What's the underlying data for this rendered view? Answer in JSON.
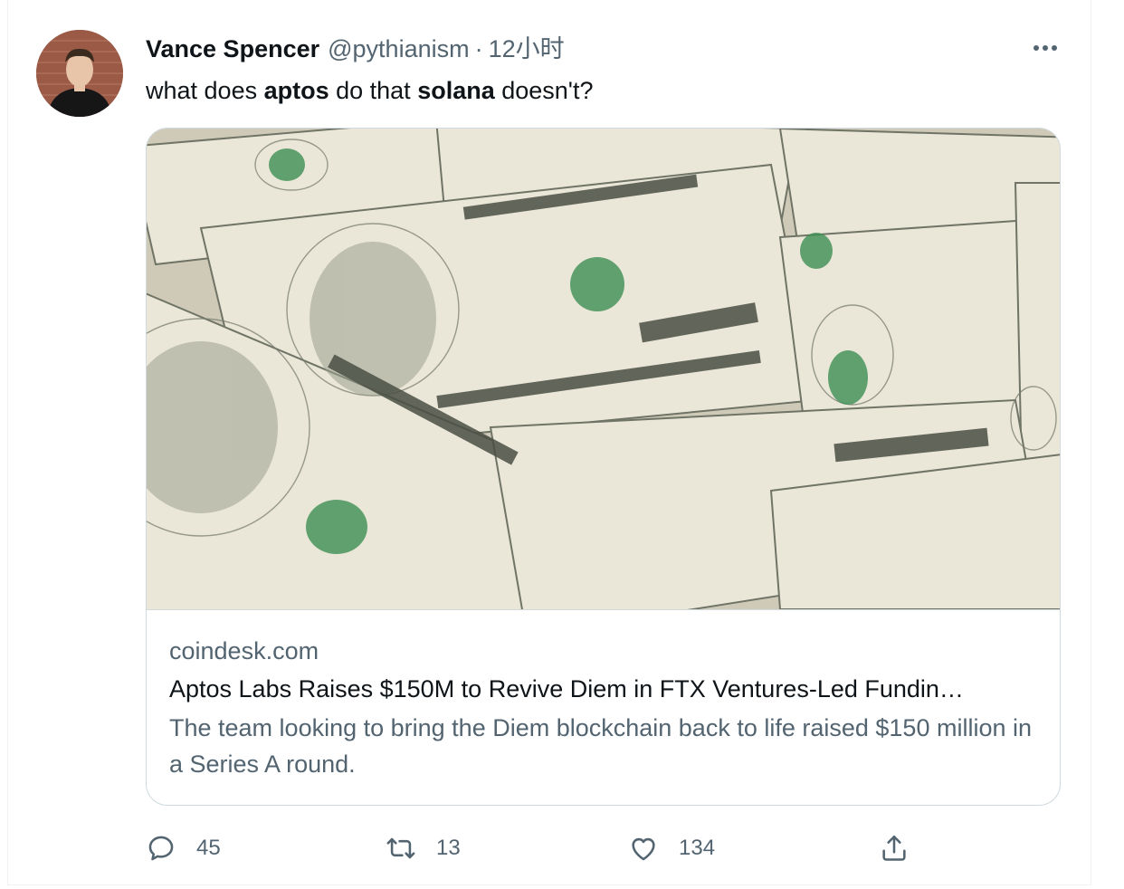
{
  "tweet": {
    "author_name": "Vance Spencer",
    "handle": "@pythianism",
    "separator": "·",
    "time": "12小时",
    "text_parts": [
      "what does ",
      "aptos",
      " do that ",
      "solana",
      " doesn't?"
    ]
  },
  "card": {
    "domain": "coindesk.com",
    "title": "Aptos Labs Raises $150M to Revive Diem in FTX Ventures-Led Fundin…",
    "description": "The team looking to bring the Diem blockchain back to life raised $150 million in a Series A round."
  },
  "actions": {
    "reply_count": "45",
    "retweet_count": "13",
    "like_count": "134"
  },
  "icons": [
    "more-icon",
    "reply-icon",
    "retweet-icon",
    "like-icon",
    "share-icon"
  ],
  "colors": {
    "text": "#0f1419",
    "secondary": "#536471",
    "border": "#cfd9de"
  }
}
